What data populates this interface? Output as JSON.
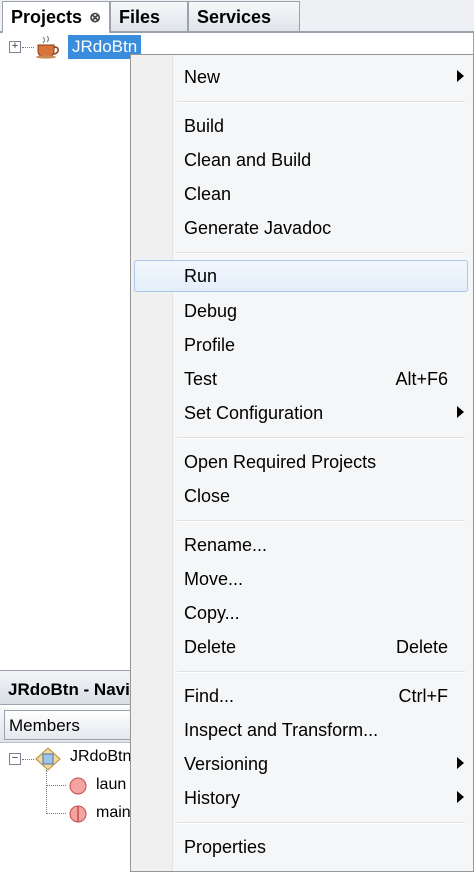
{
  "tabs": [
    {
      "label": "Projects",
      "close": "⊗"
    },
    {
      "label": "Files"
    },
    {
      "label": "Services"
    }
  ],
  "project_tree": {
    "root_label": "JRdoBtn",
    "expander": "+"
  },
  "navigator": {
    "title": "JRdoBtn - Navig",
    "members_label": "Members",
    "tree": {
      "root": "JRdoBtn",
      "expander": "−",
      "items": [
        "laun",
        "main"
      ]
    }
  },
  "context_menu": {
    "items": {
      "new": {
        "label": "New"
      },
      "build": {
        "label": "Build"
      },
      "clean_build": {
        "label": "Clean and Build"
      },
      "clean": {
        "label": "Clean"
      },
      "javadoc": {
        "label": "Generate Javadoc"
      },
      "run": {
        "label": "Run"
      },
      "debug": {
        "label": "Debug"
      },
      "profile": {
        "label": "Profile"
      },
      "test": {
        "label": "Test",
        "shortcut": "Alt+F6"
      },
      "set_config": {
        "label": "Set Configuration"
      },
      "open_required": {
        "label": "Open Required Projects"
      },
      "close": {
        "label": "Close"
      },
      "rename": {
        "label": "Rename..."
      },
      "move": {
        "label": "Move..."
      },
      "copy": {
        "label": "Copy..."
      },
      "delete": {
        "label": "Delete",
        "shortcut": "Delete"
      },
      "find": {
        "label": "Find...",
        "shortcut": "Ctrl+F"
      },
      "inspect": {
        "label": "Inspect and Transform..."
      },
      "versioning": {
        "label": "Versioning"
      },
      "history": {
        "label": "History"
      },
      "properties": {
        "label": "Properties"
      }
    }
  },
  "colors": {
    "selection": "#3a8cdc",
    "menu_hover_border": "#a8c8ec",
    "menu_background": "#f5f6f7"
  }
}
